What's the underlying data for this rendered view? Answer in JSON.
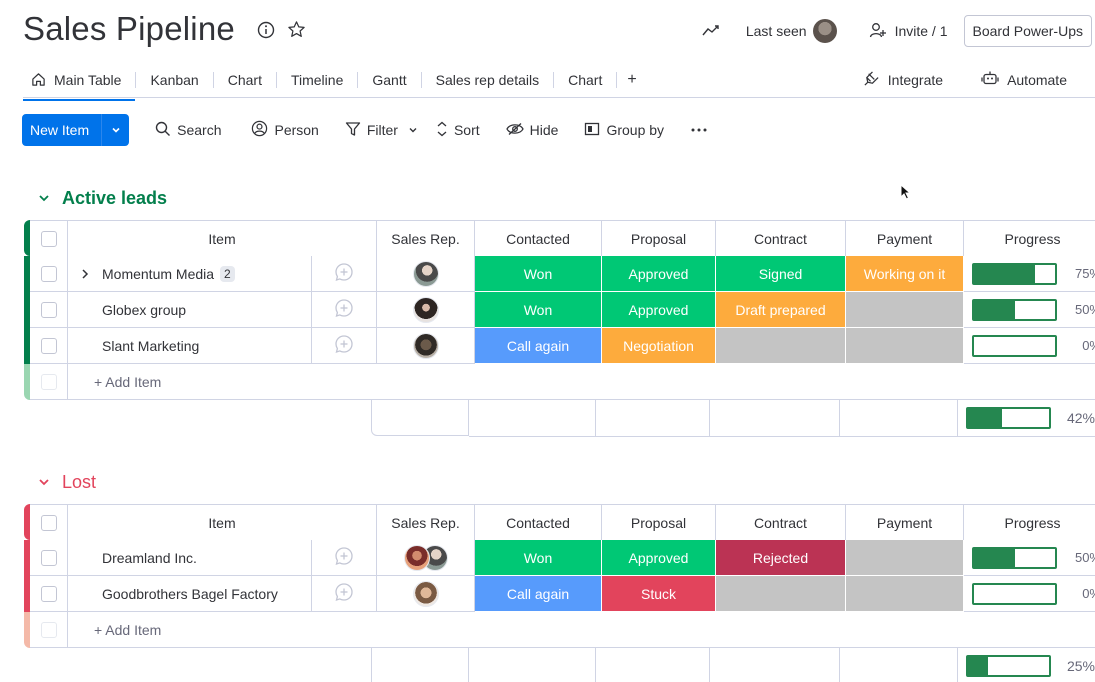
{
  "header": {
    "title": "Sales Pipeline",
    "last_seen_label": "Last seen",
    "invite_label": "Invite / 1",
    "power_ups_label": "Board Power-Ups"
  },
  "tabs": [
    {
      "label": "Main Table",
      "active": true
    },
    {
      "label": "Kanban"
    },
    {
      "label": "Chart"
    },
    {
      "label": "Timeline"
    },
    {
      "label": "Gantt"
    },
    {
      "label": "Sales rep details"
    },
    {
      "label": "Chart"
    },
    {
      "label": "+"
    }
  ],
  "tabs_right": {
    "integrate": "Integrate",
    "automate": "Automate"
  },
  "toolbar": {
    "new_item": "New Item",
    "search": "Search",
    "person": "Person",
    "filter": "Filter",
    "sort": "Sort",
    "hide": "Hide",
    "group_by": "Group by"
  },
  "columns": {
    "item": "Item",
    "rep": "Sales Rep.",
    "contacted": "Contacted",
    "proposal": "Proposal",
    "contract": "Contract",
    "payment": "Payment",
    "progress": "Progress"
  },
  "colors": {
    "won": "#00c875",
    "approved": "#00c875",
    "signed": "#00c875",
    "working": "#fdab3d",
    "draft": "#fdab3d",
    "negotiation": "#fdab3d",
    "call_again": "#579bfc",
    "stuck": "#e2445c",
    "rejected": "#bb3354",
    "empty": "#c4c4c4",
    "active_group": "#037f4c",
    "lost_group": "#e2445c",
    "progress": "#258750"
  },
  "add_item_label": "+ Add Item",
  "groups": [
    {
      "title": "Active leads",
      "rows": [
        {
          "name": "Momentum Media",
          "subitems": "2",
          "contacted": "Won",
          "proposal": "Approved",
          "contract": "Signed",
          "payment": "Working on it",
          "progress": "75%",
          "progress_value": 0.75
        },
        {
          "name": "Globex group",
          "contacted": "Won",
          "proposal": "Approved",
          "contract": "Draft prepared",
          "payment": "",
          "progress": "50%",
          "progress_value": 0.5
        },
        {
          "name": "Slant Marketing",
          "contacted": "Call again",
          "proposal": "Negotiation",
          "contract": "",
          "payment": "",
          "progress": "0%",
          "progress_value": 0
        }
      ],
      "summary": {
        "progress": "42%",
        "progress_value": 0.42
      }
    },
    {
      "title": "Lost",
      "rows": [
        {
          "name": "Dreamland Inc.",
          "contacted": "Won",
          "proposal": "Approved",
          "contract": "Rejected",
          "payment": "",
          "progress": "50%",
          "progress_value": 0.5
        },
        {
          "name": "Goodbrothers Bagel Factory",
          "contacted": "Call again",
          "proposal": "Stuck",
          "contract": "",
          "payment": "",
          "progress": "0%",
          "progress_value": 0
        }
      ],
      "summary": {
        "progress": "25%",
        "progress_value": 0.25
      }
    }
  ]
}
